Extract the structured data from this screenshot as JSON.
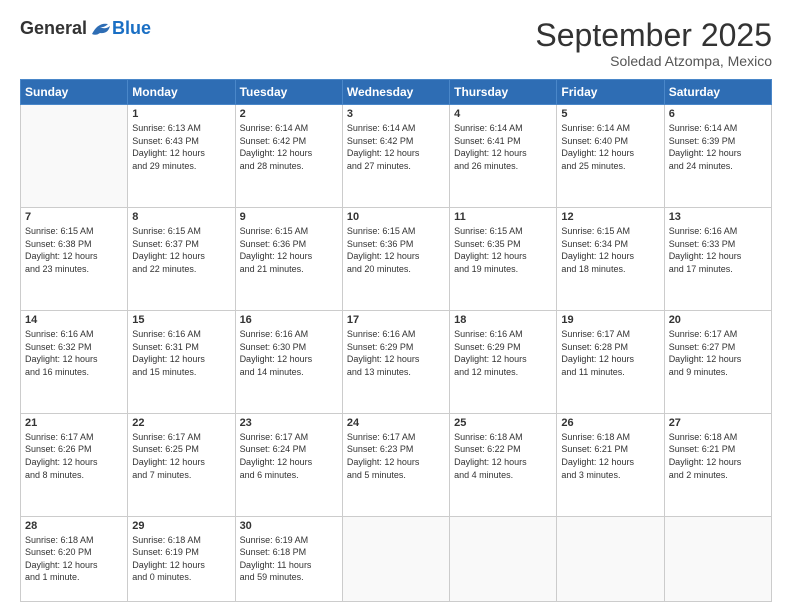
{
  "logo": {
    "general": "General",
    "blue": "Blue"
  },
  "header": {
    "month": "September 2025",
    "location": "Soledad Atzompa, Mexico"
  },
  "weekdays": [
    "Sunday",
    "Monday",
    "Tuesday",
    "Wednesday",
    "Thursday",
    "Friday",
    "Saturday"
  ],
  "weeks": [
    [
      {
        "day": "",
        "info": ""
      },
      {
        "day": "1",
        "info": "Sunrise: 6:13 AM\nSunset: 6:43 PM\nDaylight: 12 hours\nand 29 minutes."
      },
      {
        "day": "2",
        "info": "Sunrise: 6:14 AM\nSunset: 6:42 PM\nDaylight: 12 hours\nand 28 minutes."
      },
      {
        "day": "3",
        "info": "Sunrise: 6:14 AM\nSunset: 6:42 PM\nDaylight: 12 hours\nand 27 minutes."
      },
      {
        "day": "4",
        "info": "Sunrise: 6:14 AM\nSunset: 6:41 PM\nDaylight: 12 hours\nand 26 minutes."
      },
      {
        "day": "5",
        "info": "Sunrise: 6:14 AM\nSunset: 6:40 PM\nDaylight: 12 hours\nand 25 minutes."
      },
      {
        "day": "6",
        "info": "Sunrise: 6:14 AM\nSunset: 6:39 PM\nDaylight: 12 hours\nand 24 minutes."
      }
    ],
    [
      {
        "day": "7",
        "info": "Sunrise: 6:15 AM\nSunset: 6:38 PM\nDaylight: 12 hours\nand 23 minutes."
      },
      {
        "day": "8",
        "info": "Sunrise: 6:15 AM\nSunset: 6:37 PM\nDaylight: 12 hours\nand 22 minutes."
      },
      {
        "day": "9",
        "info": "Sunrise: 6:15 AM\nSunset: 6:36 PM\nDaylight: 12 hours\nand 21 minutes."
      },
      {
        "day": "10",
        "info": "Sunrise: 6:15 AM\nSunset: 6:36 PM\nDaylight: 12 hours\nand 20 minutes."
      },
      {
        "day": "11",
        "info": "Sunrise: 6:15 AM\nSunset: 6:35 PM\nDaylight: 12 hours\nand 19 minutes."
      },
      {
        "day": "12",
        "info": "Sunrise: 6:15 AM\nSunset: 6:34 PM\nDaylight: 12 hours\nand 18 minutes."
      },
      {
        "day": "13",
        "info": "Sunrise: 6:16 AM\nSunset: 6:33 PM\nDaylight: 12 hours\nand 17 minutes."
      }
    ],
    [
      {
        "day": "14",
        "info": "Sunrise: 6:16 AM\nSunset: 6:32 PM\nDaylight: 12 hours\nand 16 minutes."
      },
      {
        "day": "15",
        "info": "Sunrise: 6:16 AM\nSunset: 6:31 PM\nDaylight: 12 hours\nand 15 minutes."
      },
      {
        "day": "16",
        "info": "Sunrise: 6:16 AM\nSunset: 6:30 PM\nDaylight: 12 hours\nand 14 minutes."
      },
      {
        "day": "17",
        "info": "Sunrise: 6:16 AM\nSunset: 6:29 PM\nDaylight: 12 hours\nand 13 minutes."
      },
      {
        "day": "18",
        "info": "Sunrise: 6:16 AM\nSunset: 6:29 PM\nDaylight: 12 hours\nand 12 minutes."
      },
      {
        "day": "19",
        "info": "Sunrise: 6:17 AM\nSunset: 6:28 PM\nDaylight: 12 hours\nand 11 minutes."
      },
      {
        "day": "20",
        "info": "Sunrise: 6:17 AM\nSunset: 6:27 PM\nDaylight: 12 hours\nand 9 minutes."
      }
    ],
    [
      {
        "day": "21",
        "info": "Sunrise: 6:17 AM\nSunset: 6:26 PM\nDaylight: 12 hours\nand 8 minutes."
      },
      {
        "day": "22",
        "info": "Sunrise: 6:17 AM\nSunset: 6:25 PM\nDaylight: 12 hours\nand 7 minutes."
      },
      {
        "day": "23",
        "info": "Sunrise: 6:17 AM\nSunset: 6:24 PM\nDaylight: 12 hours\nand 6 minutes."
      },
      {
        "day": "24",
        "info": "Sunrise: 6:17 AM\nSunset: 6:23 PM\nDaylight: 12 hours\nand 5 minutes."
      },
      {
        "day": "25",
        "info": "Sunrise: 6:18 AM\nSunset: 6:22 PM\nDaylight: 12 hours\nand 4 minutes."
      },
      {
        "day": "26",
        "info": "Sunrise: 6:18 AM\nSunset: 6:21 PM\nDaylight: 12 hours\nand 3 minutes."
      },
      {
        "day": "27",
        "info": "Sunrise: 6:18 AM\nSunset: 6:21 PM\nDaylight: 12 hours\nand 2 minutes."
      }
    ],
    [
      {
        "day": "28",
        "info": "Sunrise: 6:18 AM\nSunset: 6:20 PM\nDaylight: 12 hours\nand 1 minute."
      },
      {
        "day": "29",
        "info": "Sunrise: 6:18 AM\nSunset: 6:19 PM\nDaylight: 12 hours\nand 0 minutes."
      },
      {
        "day": "30",
        "info": "Sunrise: 6:19 AM\nSunset: 6:18 PM\nDaylight: 11 hours\nand 59 minutes."
      },
      {
        "day": "",
        "info": ""
      },
      {
        "day": "",
        "info": ""
      },
      {
        "day": "",
        "info": ""
      },
      {
        "day": "",
        "info": ""
      }
    ]
  ]
}
